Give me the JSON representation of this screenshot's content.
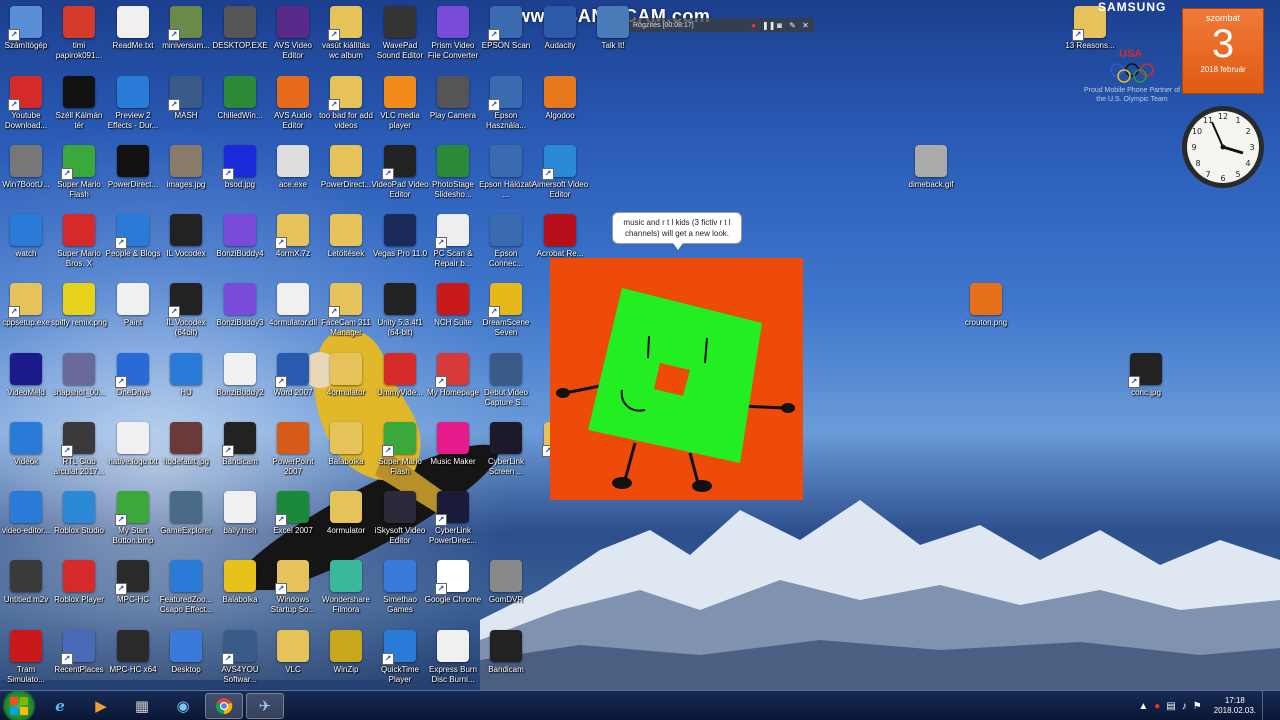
{
  "watermark": {
    "text": "www.BANDICAM.com",
    "recording_label": "Rögzítés [00:08:17]"
  },
  "brand": {
    "samsung": "SAMSUNG",
    "reasons": "13 Reasons...",
    "usa": "USA",
    "olympic_partner": "Proud Mobile Phone Partner of the U.S. Olympic Team"
  },
  "calendar": {
    "weekday": "szombat",
    "day": "3",
    "month_year": "2018 február"
  },
  "bubble": {
    "text": "music and r t l kids (3 fictiv r t l channels) will get a new look."
  },
  "taskbar": {
    "time": "17:18",
    "date": "2018.02.03."
  },
  "icons": [
    {
      "label": "Számítógép",
      "icon": "computer-icon",
      "color": "#5a8fd8"
    },
    {
      "label": "timi papirok091...",
      "icon": "pdf-icon",
      "color": "#d63a2a"
    },
    {
      "label": "ReadMe.txt",
      "icon": "text-file-icon",
      "color": "#f0f0f0"
    },
    {
      "label": "miniversum...",
      "icon": "image-icon",
      "color": "#6a8a4a"
    },
    {
      "label": "DESKTOP.EXE",
      "icon": "tool-icon",
      "color": "#555555"
    },
    {
      "label": "AVS Video Editor",
      "icon": "film-icon",
      "color": "#5a2a8a"
    },
    {
      "label": "vasút kiállítás wc album",
      "icon": "folder-icon",
      "color": "#e6c35a"
    },
    {
      "label": "WavePad Sound Editor",
      "icon": "wave-icon",
      "color": "#333333"
    },
    {
      "label": "Prism Video File Converter",
      "icon": "prism-icon",
      "color": "#7a4ad8"
    },
    {
      "label": "EPSON Scan",
      "icon": "scanner-icon",
      "color": "#3a6ab0"
    },
    {
      "label": "Audacity",
      "icon": "headphones-icon",
      "color": "#2a5aa8"
    },
    {
      "label": "Talk It!",
      "icon": "talk-icon",
      "color": "#4a7ab8"
    },
    {
      "label": "Youtube Download...",
      "icon": "youtube-icon",
      "color": "#d62a2a"
    },
    {
      "label": "Széll Kálmán tér",
      "icon": "5d-icon",
      "color": "#111111"
    },
    {
      "label": "Preview 2 Effects - Dur...",
      "icon": "ie-icon",
      "color": "#2a7ad8"
    },
    {
      "label": "MASH",
      "icon": "helicopter-icon",
      "color": "#3a5a8a"
    },
    {
      "label": "ChilledWin...",
      "icon": "windows-icon",
      "color": "#2a8a3a"
    },
    {
      "label": "AVS Audio Editor",
      "icon": "audio-icon",
      "color": "#e66a1a"
    },
    {
      "label": "too bad for add videos",
      "icon": "folder-icon",
      "color": "#e6c35a"
    },
    {
      "label": "VLC media player",
      "icon": "vlc-icon",
      "color": "#f08a1a"
    },
    {
      "label": "Play Camera",
      "icon": "camera-icon",
      "color": "#555555"
    },
    {
      "label": "Epson Használa...",
      "icon": "epson-icon",
      "color": "#3a6ab0"
    },
    {
      "label": "Algodoo",
      "icon": "algodoo-icon",
      "color": "#e6781a"
    },
    {
      "label": "Win7BootU...",
      "icon": "boot-icon",
      "color": "#777777"
    },
    {
      "label": "Super Mario Flash",
      "icon": "mario-icon",
      "color": "#3aa83a"
    },
    {
      "label": "PowerDirect...",
      "icon": "cyberlink-icon",
      "color": "#111111"
    },
    {
      "label": "images.jpg",
      "icon": "image-icon",
      "color": "#8a7a6a"
    },
    {
      "label": "bsod.jpg",
      "icon": "image-icon",
      "color": "#1a2ad8"
    },
    {
      "label": "ace.exe",
      "icon": "exe-icon",
      "color": "#dddddd"
    },
    {
      "label": "PowerDirect...",
      "icon": "folder-icon",
      "color": "#e6c35a"
    },
    {
      "label": "VideoPad Video Editor",
      "icon": "star-icon",
      "color": "#222222"
    },
    {
      "label": "PhotoStage Slidesho...",
      "icon": "photostage-icon",
      "color": "#2a8a3a"
    },
    {
      "label": "Epson Hálózati ...",
      "icon": "epson-icon",
      "color": "#3a6ab0"
    },
    {
      "label": "Aimersoft Video Editor",
      "icon": "aimersoft-icon",
      "color": "#2a8ad8"
    },
    {
      "label": "watch",
      "icon": "ie-icon",
      "color": "#2a7ad8"
    },
    {
      "label": "Super Mario Bros. X",
      "icon": "mushroom-icon",
      "color": "#d62a2a"
    },
    {
      "label": "People & Blogs",
      "icon": "ie-icon",
      "color": "#2a7ad8"
    },
    {
      "label": "IL Vocodex",
      "icon": "il-icon",
      "color": "#222222"
    },
    {
      "label": "BonziBuddy4",
      "icon": "bonzi-icon",
      "color": "#7a4ad8"
    },
    {
      "label": "4ormX.7z",
      "icon": "archive-icon",
      "color": "#e6c35a"
    },
    {
      "label": "Letöltések",
      "icon": "folder-icon",
      "color": "#e6c35a"
    },
    {
      "label": "Vegas Pro 11.0",
      "icon": "vegas-icon",
      "color": "#1a2a5a"
    },
    {
      "label": "PC Scan & Repair b...",
      "icon": "re-icon",
      "color": "#eeeeee"
    },
    {
      "label": "Epson Connec...",
      "icon": "epson-icon",
      "color": "#3a6ab0"
    },
    {
      "label": "Acrobat Re...",
      "icon": "acrobat-icon",
      "color": "#b8101a"
    },
    {
      "label": "cppsetup.exe",
      "icon": "setup-icon",
      "color": "#e6c35a"
    },
    {
      "label": "spiffy remix.png",
      "icon": "image-icon",
      "color": "#e6d21a"
    },
    {
      "label": "Paint",
      "icon": "paint-icon",
      "color": "#f0f0f0"
    },
    {
      "label": "IL Vocodex (64bit)",
      "icon": "il-icon",
      "color": "#222222"
    },
    {
      "label": "BonziBuddy3",
      "icon": "bonzi-icon",
      "color": "#7a4ad8"
    },
    {
      "label": "4ormulator.dll",
      "icon": "flame-icon",
      "color": "#f0f0f0"
    },
    {
      "label": "FaceCam 311 Manager",
      "icon": "folder-icon",
      "color": "#e6c35a"
    },
    {
      "label": "Unity 5.3.4f1 (64-bit)",
      "icon": "unity-icon",
      "color": "#222222"
    },
    {
      "label": "NCH Suite",
      "icon": "nch-icon",
      "color": "#c81a1a"
    },
    {
      "label": "DreamScene Seven",
      "icon": "dreamscene-icon",
      "color": "#e6b81a"
    },
    {
      "label": "VideoMeld",
      "icon": "videomeld-icon",
      "color": "#1a1a8a"
    },
    {
      "label": "snapshot_00...",
      "icon": "image-icon",
      "color": "#6a6a9a"
    },
    {
      "label": "OneDrive",
      "icon": "cloud-icon",
      "color": "#2a6ad8"
    },
    {
      "label": "HU",
      "icon": "ie-icon",
      "color": "#2a7ad8"
    },
    {
      "label": "BonziBuddy2",
      "icon": "file-icon",
      "color": "#f0f0f0"
    },
    {
      "label": "Word 2007",
      "icon": "word-icon",
      "color": "#2a5ab0"
    },
    {
      "label": "4ormulator",
      "icon": "folder-icon",
      "color": "#e6c35a"
    },
    {
      "label": "UmmyVide...",
      "icon": "download-icon",
      "color": "#d62a2a"
    },
    {
      "label": "My Homepage",
      "icon": "home-icon",
      "color": "#d63a3a"
    },
    {
      "label": "Debut Video Capture S...",
      "icon": "debut-icon",
      "color": "#3a5a8a"
    },
    {
      "label": "Videók",
      "icon": "ie-icon",
      "color": "#2a7ad8"
    },
    {
      "label": "RTL Club arculat 2017...",
      "icon": "image-icon",
      "color": "#3a3a3a"
    },
    {
      "label": "native.logo.txt",
      "icon": "text-file-icon",
      "color": "#f0f0f0"
    },
    {
      "label": "hqdefault.jpg",
      "icon": "image-icon",
      "color": "#6a3a3a"
    },
    {
      "label": "Bandicam",
      "icon": "record-icon",
      "color": "#222222"
    },
    {
      "label": "PowerPoint 2007",
      "icon": "powerpoint-icon",
      "color": "#d65a1a"
    },
    {
      "label": "Balabolka",
      "icon": "folder-icon",
      "color": "#e6c35a"
    },
    {
      "label": "Super Mario Flash",
      "icon": "mario-icon",
      "color": "#3aa83a"
    },
    {
      "label": "Music Maker",
      "icon": "music-maker-icon",
      "color": "#e61a8a"
    },
    {
      "label": "CyberLink Screen ...",
      "icon": "screen-icon",
      "color": "#1a1a2a"
    },
    {
      "label": "Fel...",
      "icon": "folder-icon",
      "color": "#e6c35a"
    },
    {
      "label": "video-editor...",
      "icon": "ie-icon",
      "color": "#2a7ad8"
    },
    {
      "label": "Roblox Studio",
      "icon": "roblox-studio-icon",
      "color": "#2a8ad8"
    },
    {
      "label": "My Start Button.bmp",
      "icon": "image-icon",
      "color": "#3aa83a"
    },
    {
      "label": "GameExplorer",
      "icon": "game-icon",
      "color": "#4a6a8a"
    },
    {
      "label": "bally.msh",
      "icon": "file-icon",
      "color": "#f0f0f0"
    },
    {
      "label": "Excel 2007",
      "icon": "excel-icon",
      "color": "#1a8a3a"
    },
    {
      "label": "4ormulator",
      "icon": "folder-icon",
      "color": "#e6c35a"
    },
    {
      "label": "iSkysoft Video Editor",
      "icon": "iskysoft-icon",
      "color": "#2a2a3a"
    },
    {
      "label": "CyberLink PowerDirec...",
      "icon": "cyberlink-icon",
      "color": "#1a1a3a"
    },
    {
      "label": "Untitled.m2v",
      "icon": "video-file-icon",
      "color": "#3a3a3a"
    },
    {
      "label": "Roblox Player",
      "icon": "roblox-icon",
      "color": "#d62a2a"
    },
    {
      "label": "MPC-HC",
      "icon": "mpc-icon",
      "color": "#2a2a2a"
    },
    {
      "label": "FeaturedZoo... Csapo Effect...",
      "icon": "ie-icon",
      "color": "#2a7ad8"
    },
    {
      "label": "Balabolka",
      "icon": "smiley-icon",
      "color": "#e6c31a"
    },
    {
      "label": "Windows Startup So...",
      "icon": "folder-icon",
      "color": "#e6c35a"
    },
    {
      "label": "Wondershare Filmora",
      "icon": "filmora-icon",
      "color": "#3ab89a"
    },
    {
      "label": "Simethao Games",
      "icon": "plane-icon",
      "color": "#3a7ad8"
    },
    {
      "label": "Google Chrome",
      "icon": "chrome-icon",
      "color": "#ffffff"
    },
    {
      "label": "GomDVR",
      "icon": "gom-icon",
      "color": "#888888"
    },
    {
      "label": "Tram Simulato...",
      "icon": "tram-icon",
      "color": "#c81a1a"
    },
    {
      "label": "RecentPlaces",
      "icon": "recent-icon",
      "color": "#4a6ab8"
    },
    {
      "label": "MPC-HC x64",
      "icon": "mpc-icon",
      "color": "#2a2a2a"
    },
    {
      "label": "Desktop",
      "icon": "desktop-icon",
      "color": "#3a7ad8"
    },
    {
      "label": "AVS4YOU Softwar...",
      "icon": "avs-icon",
      "color": "#3a5a8a"
    },
    {
      "label": "VLC",
      "icon": "folder-icon",
      "color": "#e6c35a"
    },
    {
      "label": "WinZip",
      "icon": "winzip-icon",
      "color": "#c8a81a"
    },
    {
      "label": "QuickTime Player",
      "icon": "quicktime-icon",
      "color": "#2a7ad8"
    },
    {
      "label": "Express Burn Disc Burni...",
      "icon": "burn-icon",
      "color": "#f0f0f0"
    },
    {
      "label": "Bandicam",
      "icon": "record-icon",
      "color": "#222222"
    },
    {
      "label": "13 Reasons...",
      "icon": "folder-icon",
      "color": "#e6c35a"
    },
    {
      "label": "dimeback.gif",
      "icon": "coin-icon",
      "color": "#aaaaaa"
    },
    {
      "label": "crouton.png",
      "icon": "crouton-icon",
      "color": "#e6701a"
    },
    {
      "label": "conc.jpg",
      "icon": "image-icon",
      "color": "#222222"
    }
  ]
}
